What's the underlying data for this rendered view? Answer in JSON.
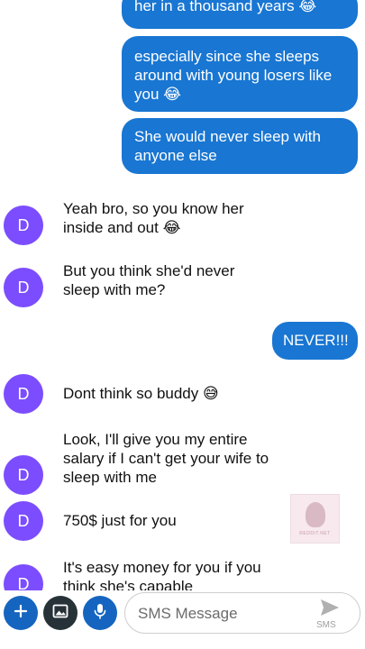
{
  "messages": {
    "out1": "her in a thousand years 😂",
    "out2": "especially since she sleeps around with young losers like you 😂",
    "out3": "She would never sleep with anyone else",
    "in1": "Yeah bro, so you know her inside and out 😂",
    "in2": "But you think she'd never sleep with me?",
    "out4": "NEVER!!!",
    "in3": "Dont think so buddy 😅",
    "in4": "Look, I'll give you my entire salary if I can't get your wife to sleep with me",
    "in5": "750$ just for you",
    "in6": "It's easy money for you if you think she's capable"
  },
  "contact": {
    "initial": "D"
  },
  "watermark": {
    "text": "REDDIT.NET"
  },
  "composer": {
    "placeholder": "SMS Message",
    "send_label": "SMS"
  },
  "colors": {
    "outgoing_bubble": "#1976d2",
    "avatar": "#7c4dff",
    "action_button": "#1565c0"
  },
  "icons": [
    "add-icon",
    "gallery-icon",
    "mic-icon",
    "send-icon"
  ]
}
